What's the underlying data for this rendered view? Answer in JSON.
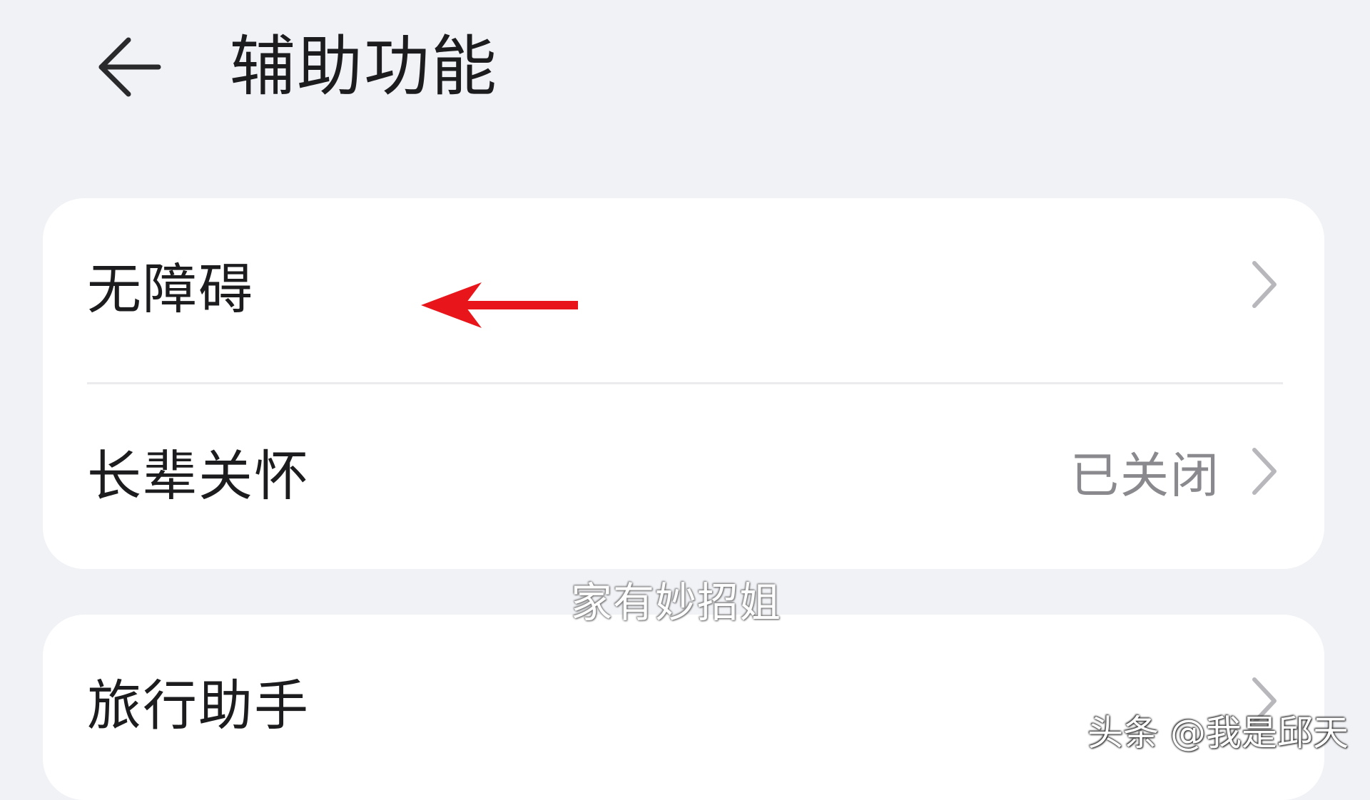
{
  "header": {
    "back_icon": "back-arrow-icon",
    "title": "辅助功能"
  },
  "cards": [
    {
      "rows": [
        {
          "label": "无障碍",
          "status": "",
          "icon": "chevron-right-icon"
        },
        {
          "label": "长辈关怀",
          "status": "已关闭",
          "icon": "chevron-right-icon"
        }
      ]
    },
    {
      "rows": [
        {
          "label": "旅行助手",
          "status": "",
          "icon": "chevron-right-icon"
        }
      ]
    }
  ],
  "annotation": {
    "icon": "red-pointer-arrow-icon",
    "color": "#e8161b"
  },
  "watermarks": {
    "center": "家有妙招姐",
    "corner": "头条 @我是邱天"
  },
  "colors": {
    "background": "#f1f2f6",
    "card": "#ffffff",
    "text_primary": "#1c1c1e",
    "text_secondary": "#8a8a8e",
    "chevron": "#b8b8bc"
  }
}
